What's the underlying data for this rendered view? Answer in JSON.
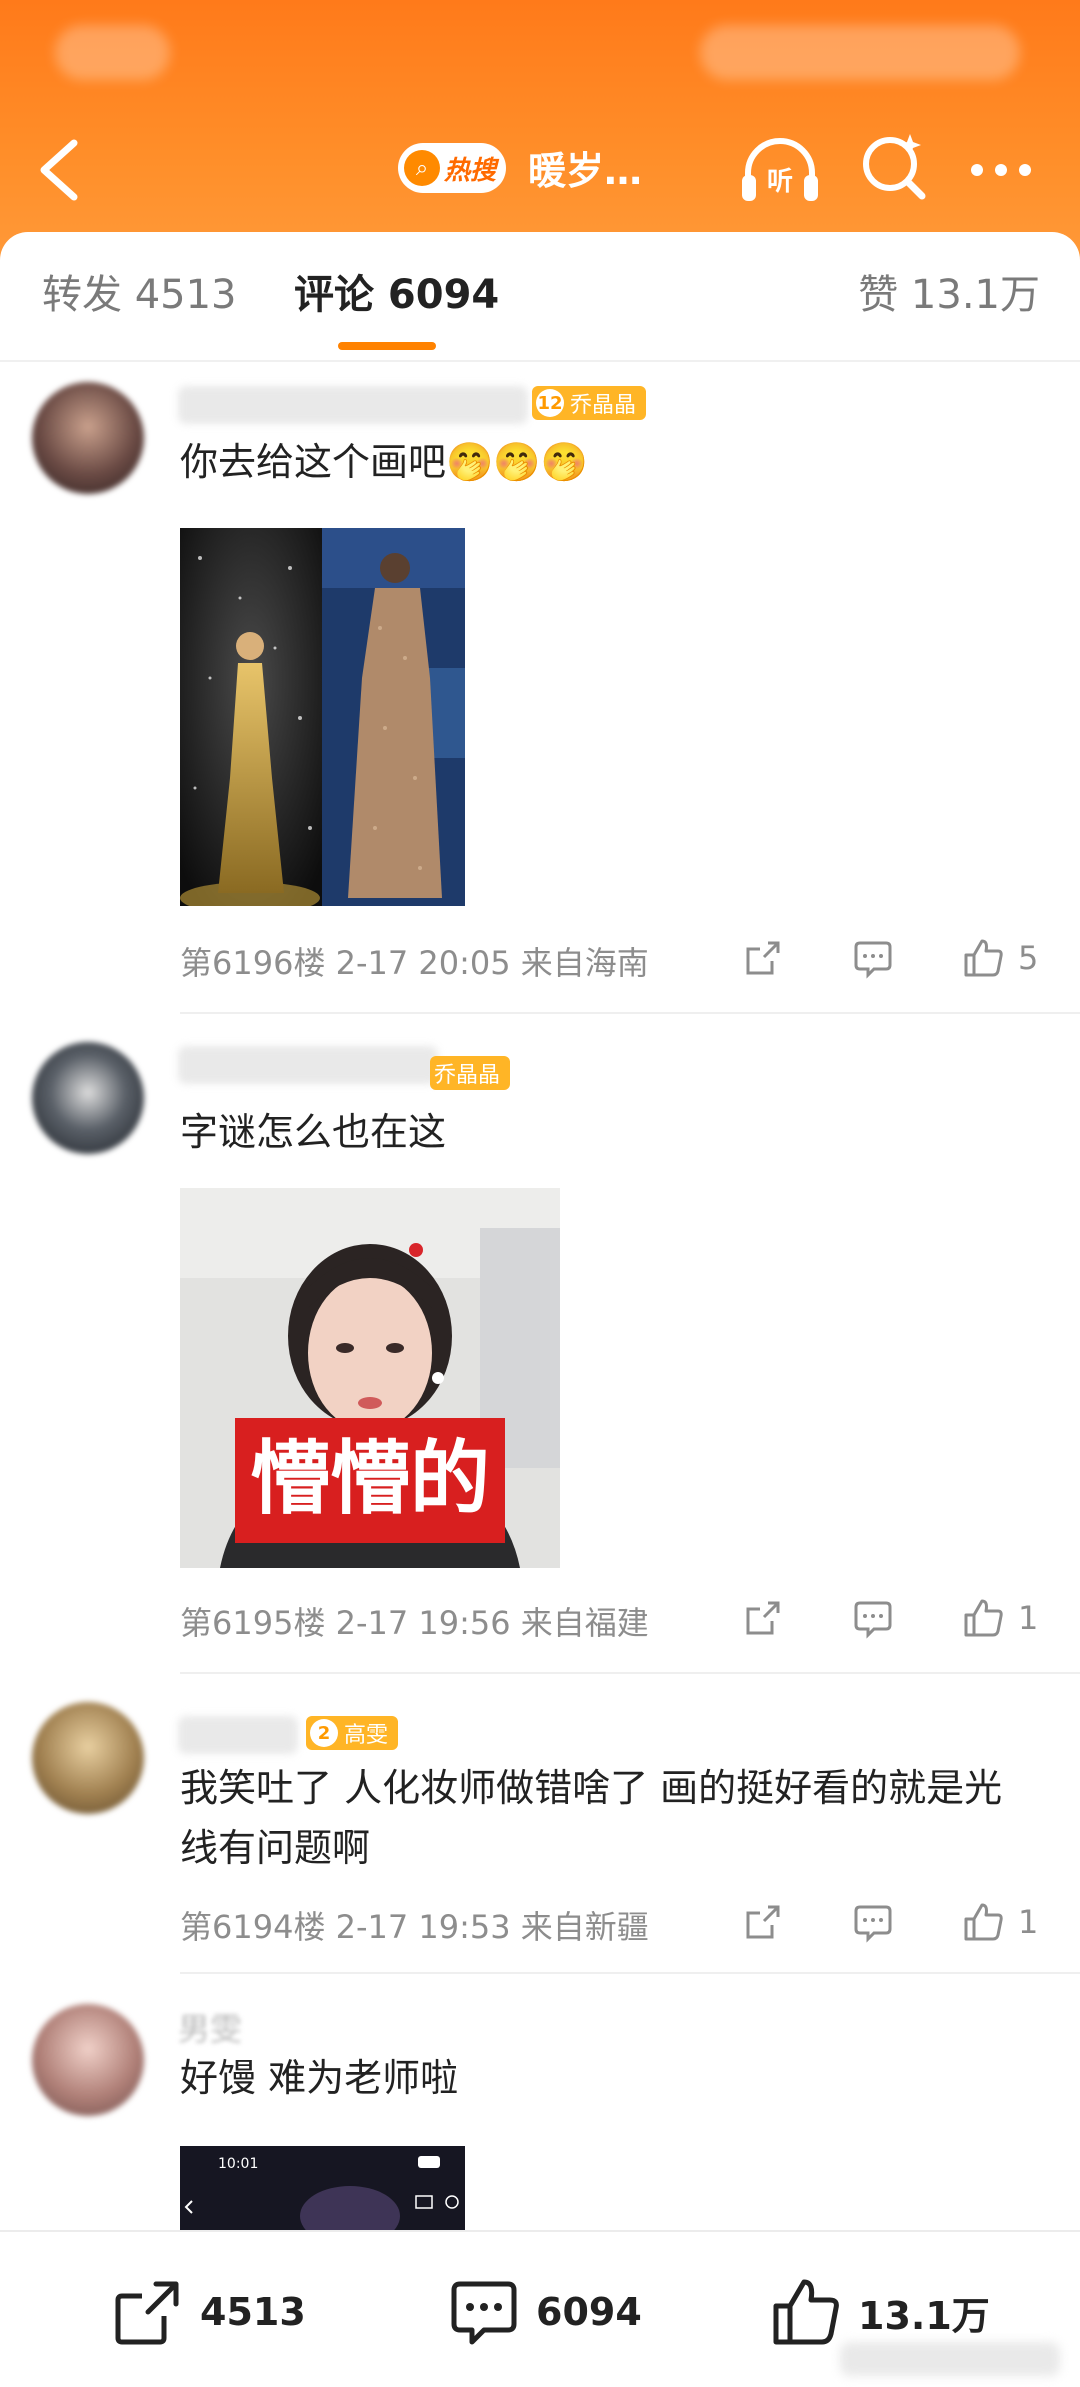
{
  "header": {
    "hot_badge": "热搜",
    "title": "暖岁…",
    "listen_label": "听"
  },
  "tabs": {
    "repost": "转发 4513",
    "comments": "评论 6094",
    "likes": "赞 13.1万"
  },
  "comments": [
    {
      "badge_level": "12",
      "badge_text": "乔晶晶",
      "text": "你去给这个画吧🤭🤭🤭",
      "meta": "第6196楼 2-17 20:05 来自海南",
      "likes": "5"
    },
    {
      "badge_level": "",
      "badge_text": "乔晶晶",
      "text": "字谜怎么也在这",
      "image_caption": "懵懵的",
      "meta": "第6195楼 2-17 19:56 来自福建",
      "likes": "1"
    },
    {
      "badge_level": "2",
      "badge_text": "高雯",
      "text": "我笑吐了 人化妆师做错啥了 画的挺好看的就是光线有问题啊",
      "meta": "第6194楼 2-17 19:53 来自新疆",
      "likes": "1"
    },
    {
      "username_visible": "男雯",
      "text": "好馒 难为老师啦",
      "image_status_time": "10:01"
    }
  ],
  "bottom_bar": {
    "reposts": "4513",
    "comments": "6094",
    "likes": "13.1万"
  },
  "colors": {
    "header_gradient_start": "#ff7a1a",
    "header_gradient_end": "#ff9a3a",
    "accent_orange": "#ff8200",
    "badge_yellow": "#ffb526",
    "caption_red": "#d81f1f"
  }
}
